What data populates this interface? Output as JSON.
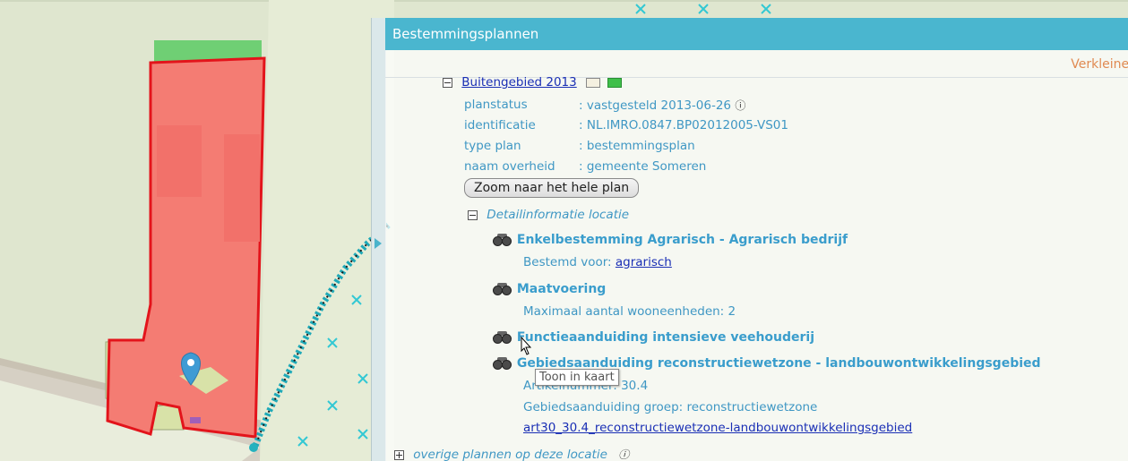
{
  "panel": {
    "title": "Bestemmingsplannen",
    "shrink_label": "Verkleinen",
    "plan": {
      "name": "Buitengebied 2013",
      "fields": [
        {
          "label": "planstatus",
          "value": ": vastgesteld 2013-06-26"
        },
        {
          "label": "identificatie",
          "value": ": NL.IMRO.0847.BP02012005-VS01"
        },
        {
          "label": "type plan",
          "value": ": bestemmingsplan"
        },
        {
          "label": "naam overheid",
          "value": ": gemeente Someren"
        }
      ],
      "zoom_button": "Zoom naar het hele plan"
    },
    "detail": {
      "title": "Detailinformatie locatie",
      "items": [
        {
          "heading": "Enkelbestemming Agrarisch - Agrarisch bedrijf",
          "lines": [
            {
              "label": "Bestemd voor: ",
              "link": "agrarisch"
            }
          ]
        },
        {
          "heading": "Maatvoering",
          "lines": [
            {
              "label": "Maximaal aantal wooneenheden: 2"
            }
          ]
        },
        {
          "heading": "Functieaanduiding intensieve veehouderij"
        },
        {
          "heading": "Gebiedsaanduiding reconstructiewetzone - landbouwontwikkelingsgebied",
          "lines": [
            {
              "label": "Artikelnummer: 30.4"
            },
            {
              "label": "Gebiedsaanduiding groep: reconstructiewetzone"
            },
            {
              "label": "",
              "link": "art30_30.4_reconstructiewetzone-landbouwontwikkelingsgebied"
            }
          ]
        }
      ]
    },
    "other_plans": "overige plannen op deze locatie",
    "tooltip": "Toon in kaart"
  },
  "icons": {
    "info": "info-icon",
    "binoculars": "binoculars-icon",
    "location_pin": "location-pin-icon",
    "cursor": "pointer-cursor-icon"
  },
  "colors": {
    "header": "#4ab6cf",
    "parcel_fill": "#f47c73",
    "parcel_border": "#e3141b",
    "link": "#1a2fb5",
    "heading": "#3a9dcc",
    "shrink": "#e08a52"
  }
}
